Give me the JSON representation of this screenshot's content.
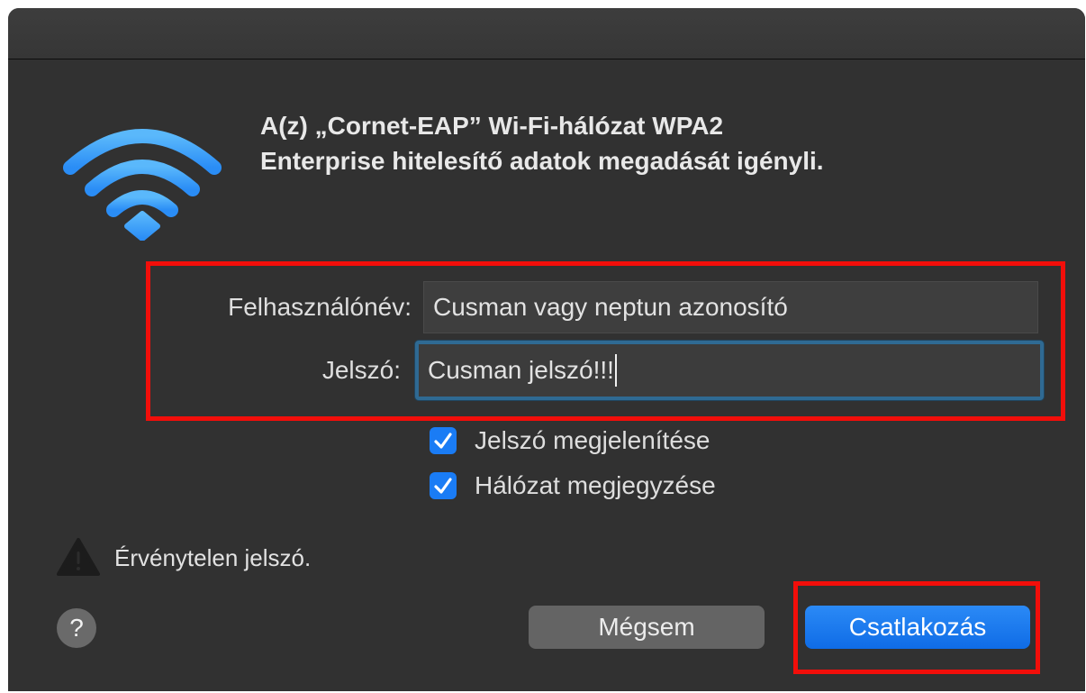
{
  "dialog": {
    "title_line1": "A(z) „Cornet-EAP” Wi-Fi-hálózat WPA2",
    "title_line2": "Enterprise hitelesítő adatok megadását igényli."
  },
  "form": {
    "username_label": "Felhasználónév:",
    "username_value": "Cusman vagy neptun azonosító",
    "password_label": "Jelszó:",
    "password_value": "Cusman jelszó!!!"
  },
  "options": {
    "show_password_label": "Jelszó megjelenítése",
    "show_password_checked": true,
    "remember_network_label": "Hálózat megjegyzése",
    "remember_network_checked": true
  },
  "status": {
    "warning_text": "Érvénytelen jelszó."
  },
  "buttons": {
    "help_label": "?",
    "cancel_label": "Mégsem",
    "connect_label": "Csatlakozás"
  },
  "colors": {
    "wifi_icon": "#3aa0f8",
    "annotation_red": "#f20e0a",
    "primary_button": "#1a7cf5",
    "dialog_background": "#313131"
  },
  "icons": {
    "wifi": "wifi-icon",
    "warning": "warning-icon",
    "checkmark": "checkmark-icon",
    "help": "help-icon"
  }
}
